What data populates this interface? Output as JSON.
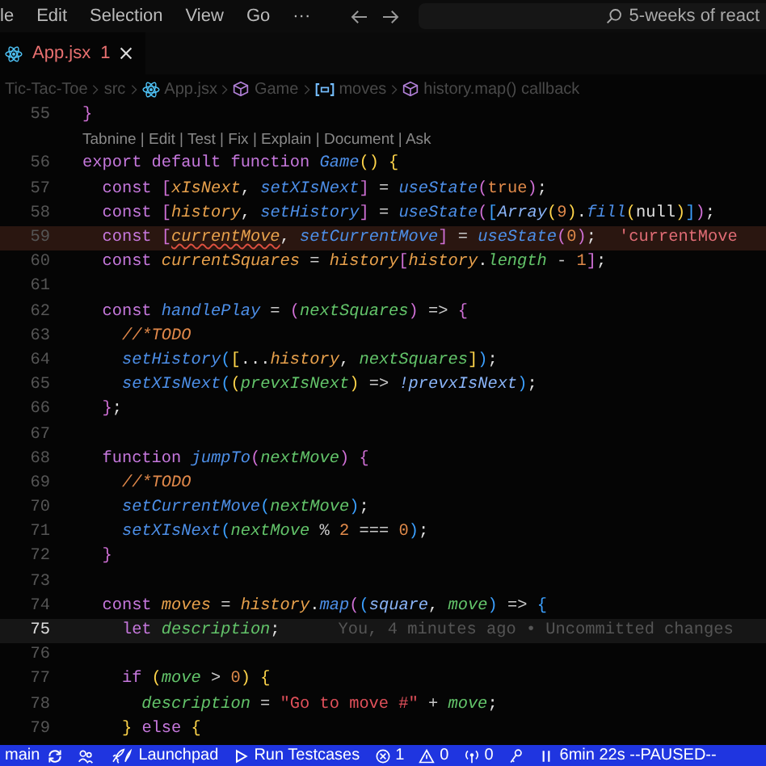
{
  "menu": [
    "le",
    "Edit",
    "Selection",
    "View",
    "Go",
    "···"
  ],
  "search": {
    "value": "5-weeks of react"
  },
  "tab": {
    "label": "App.jsx",
    "problems": "1"
  },
  "breadcrumb": [
    {
      "kind": "folder",
      "label": "Tic-Tac-Toe"
    },
    {
      "kind": "folder",
      "label": "src"
    },
    {
      "kind": "react",
      "label": "App.jsx"
    },
    {
      "kind": "symbol",
      "label": "Game"
    },
    {
      "kind": "variable",
      "label": "moves"
    },
    {
      "kind": "symbol",
      "label": "history.map() callback"
    }
  ],
  "lines": [
    {
      "number": "55",
      "tokens": [
        {
          "kind": "b2",
          "t": "}"
        }
      ]
    },
    {
      "number": "56",
      "codelens": "Tabnine | Edit | Test | Fix | Explain | Document | Ask",
      "tokens": [
        {
          "kind": "kw",
          "t": "export default function "
        },
        {
          "kind": "fn",
          "t": "Game"
        },
        {
          "kind": "b1",
          "t": "() {"
        }
      ]
    },
    {
      "number": "57",
      "tokens": [
        {
          "kind": "kw",
          "t": "  const "
        },
        {
          "kind": "b2",
          "t": "["
        },
        {
          "kind": "var",
          "t": "xIsNext"
        },
        {
          "kind": "pn",
          "t": ", "
        },
        {
          "kind": "fn",
          "t": "setXIsNext"
        },
        {
          "kind": "b2",
          "t": "]"
        },
        {
          "kind": "op",
          "t": " = "
        },
        {
          "kind": "fn",
          "t": "useState"
        },
        {
          "kind": "b2",
          "t": "("
        },
        {
          "kind": "num",
          "t": "true"
        },
        {
          "kind": "b2",
          "t": ")"
        },
        {
          "kind": "pn",
          "t": ";"
        }
      ]
    },
    {
      "number": "58",
      "tokens": [
        {
          "kind": "kw",
          "t": "  const "
        },
        {
          "kind": "b2",
          "t": "["
        },
        {
          "kind": "var",
          "t": "history"
        },
        {
          "kind": "pn",
          "t": ", "
        },
        {
          "kind": "fn",
          "t": "setHistory"
        },
        {
          "kind": "b2",
          "t": "]"
        },
        {
          "kind": "op",
          "t": " = "
        },
        {
          "kind": "fn",
          "t": "useState"
        },
        {
          "kind": "b2",
          "t": "("
        },
        {
          "kind": "b3",
          "t": "["
        },
        {
          "kind": "ref",
          "t": "Array"
        },
        {
          "kind": "b1",
          "t": "("
        },
        {
          "kind": "num",
          "t": "9"
        },
        {
          "kind": "b1",
          "t": ")"
        },
        {
          "kind": "pn",
          "t": "."
        },
        {
          "kind": "fn",
          "t": "fill"
        },
        {
          "kind": "b1",
          "t": "("
        },
        {
          "kind": "pn",
          "t": "null"
        },
        {
          "kind": "b1",
          "t": ")"
        },
        {
          "kind": "b3",
          "t": "]"
        },
        {
          "kind": "b2",
          "t": ")"
        },
        {
          "kind": "pn",
          "t": ";"
        }
      ]
    },
    {
      "number": "59",
      "error": true,
      "hint": "'currentMove",
      "tokens": [
        {
          "kind": "kw",
          "t": "  const "
        },
        {
          "kind": "b2",
          "t": "["
        },
        {
          "kind": "var",
          "t": "currentMove",
          "squiggle": true
        },
        {
          "kind": "pn",
          "t": ", "
        },
        {
          "kind": "fn",
          "t": "setCurrentMove"
        },
        {
          "kind": "b2",
          "t": "]"
        },
        {
          "kind": "op",
          "t": " = "
        },
        {
          "kind": "fn",
          "t": "useState"
        },
        {
          "kind": "b2",
          "t": "("
        },
        {
          "kind": "num",
          "t": "0"
        },
        {
          "kind": "b2",
          "t": ")"
        },
        {
          "kind": "pn",
          "t": ";"
        }
      ]
    },
    {
      "number": "60",
      "tokens": [
        {
          "kind": "kw",
          "t": "  const "
        },
        {
          "kind": "var",
          "t": "currentSquares"
        },
        {
          "kind": "op",
          "t": " = "
        },
        {
          "kind": "var",
          "t": "history"
        },
        {
          "kind": "b2",
          "t": "["
        },
        {
          "kind": "var",
          "t": "history"
        },
        {
          "kind": "pn",
          "t": "."
        },
        {
          "kind": "prop",
          "t": "length"
        },
        {
          "kind": "op",
          "t": " - "
        },
        {
          "kind": "num",
          "t": "1"
        },
        {
          "kind": "b2",
          "t": "]"
        },
        {
          "kind": "pn",
          "t": ";"
        }
      ]
    },
    {
      "number": "61"
    },
    {
      "number": "62",
      "tokens": [
        {
          "kind": "kw",
          "t": "  const "
        },
        {
          "kind": "fn",
          "t": "handlePlay"
        },
        {
          "kind": "op",
          "t": " = "
        },
        {
          "kind": "b2",
          "t": "("
        },
        {
          "kind": "param",
          "t": "nextSquares"
        },
        {
          "kind": "b2",
          "t": ")"
        },
        {
          "kind": "op",
          "t": " => "
        },
        {
          "kind": "b2",
          "t": "{"
        }
      ]
    },
    {
      "number": "63",
      "tokens": [
        {
          "kind": "com",
          "t": "    //*TODO"
        }
      ]
    },
    {
      "number": "64",
      "tokens": [
        {
          "kind": "fn",
          "t": "    setHistory"
        },
        {
          "kind": "b3",
          "t": "("
        },
        {
          "kind": "b1",
          "t": "["
        },
        {
          "kind": "pn",
          "t": "..."
        },
        {
          "kind": "var",
          "t": "history"
        },
        {
          "kind": "pn",
          "t": ", "
        },
        {
          "kind": "param",
          "t": "nextSquares"
        },
        {
          "kind": "b1",
          "t": "]"
        },
        {
          "kind": "b3",
          "t": ")"
        },
        {
          "kind": "pn",
          "t": ";"
        }
      ]
    },
    {
      "number": "65",
      "tokens": [
        {
          "kind": "fn",
          "t": "    setXIsNext"
        },
        {
          "kind": "b3",
          "t": "("
        },
        {
          "kind": "b1",
          "t": "("
        },
        {
          "kind": "param",
          "t": "prevxIsNext"
        },
        {
          "kind": "b1",
          "t": ")"
        },
        {
          "kind": "op",
          "t": " => "
        },
        {
          "kind": "ref",
          "t": "!prevxIsNext"
        },
        {
          "kind": "b3",
          "t": ")"
        },
        {
          "kind": "pn",
          "t": ";"
        }
      ]
    },
    {
      "number": "66",
      "tokens": [
        {
          "kind": "b2",
          "t": "  }"
        },
        {
          "kind": "pn",
          "t": ";"
        }
      ]
    },
    {
      "number": "67"
    },
    {
      "number": "68",
      "tokens": [
        {
          "kind": "kw",
          "t": "  function "
        },
        {
          "kind": "fn",
          "t": "jumpTo"
        },
        {
          "kind": "b2",
          "t": "("
        },
        {
          "kind": "param",
          "t": "nextMove"
        },
        {
          "kind": "b2",
          "t": ") {"
        }
      ]
    },
    {
      "number": "69",
      "tokens": [
        {
          "kind": "com",
          "t": "    //*TODO"
        }
      ]
    },
    {
      "number": "70",
      "tokens": [
        {
          "kind": "fn",
          "t": "    setCurrentMove"
        },
        {
          "kind": "b3",
          "t": "("
        },
        {
          "kind": "param",
          "t": "nextMove"
        },
        {
          "kind": "b3",
          "t": ")"
        },
        {
          "kind": "pn",
          "t": ";"
        }
      ]
    },
    {
      "number": "71",
      "tokens": [
        {
          "kind": "fn",
          "t": "    setXIsNext"
        },
        {
          "kind": "b3",
          "t": "("
        },
        {
          "kind": "param",
          "t": "nextMove"
        },
        {
          "kind": "op",
          "t": " % "
        },
        {
          "kind": "num",
          "t": "2"
        },
        {
          "kind": "op",
          "t": " === "
        },
        {
          "kind": "num",
          "t": "0"
        },
        {
          "kind": "b3",
          "t": ")"
        },
        {
          "kind": "pn",
          "t": ";"
        }
      ]
    },
    {
      "number": "72",
      "tokens": [
        {
          "kind": "b2",
          "t": "  }"
        }
      ]
    },
    {
      "number": "73"
    },
    {
      "number": "74",
      "tokens": [
        {
          "kind": "kw",
          "t": "  const "
        },
        {
          "kind": "var",
          "t": "moves"
        },
        {
          "kind": "op",
          "t": " = "
        },
        {
          "kind": "var",
          "t": "history"
        },
        {
          "kind": "pn",
          "t": "."
        },
        {
          "kind": "fn",
          "t": "map"
        },
        {
          "kind": "b2",
          "t": "("
        },
        {
          "kind": "b3",
          "t": "("
        },
        {
          "kind": "ref",
          "t": "square"
        },
        {
          "kind": "pn",
          "t": ", "
        },
        {
          "kind": "param",
          "t": "move"
        },
        {
          "kind": "b3",
          "t": ")"
        },
        {
          "kind": "op",
          "t": " => "
        },
        {
          "kind": "b3",
          "t": "{"
        }
      ]
    },
    {
      "number": "75",
      "current": true,
      "blame": "You, 4 minutes ago • Uncommitted changes",
      "tokens": [
        {
          "kind": "kw",
          "t": "    let "
        },
        {
          "kind": "param",
          "t": "description"
        },
        {
          "kind": "pn",
          "t": ";"
        }
      ]
    },
    {
      "number": "76"
    },
    {
      "number": "77",
      "tokens": [
        {
          "kind": "kw",
          "t": "    if "
        },
        {
          "kind": "b1",
          "t": "("
        },
        {
          "kind": "param",
          "t": "move"
        },
        {
          "kind": "op",
          "t": " > "
        },
        {
          "kind": "num",
          "t": "0"
        },
        {
          "kind": "b1",
          "t": ") {"
        }
      ]
    },
    {
      "number": "78",
      "tokens": [
        {
          "kind": "param",
          "t": "      description"
        },
        {
          "kind": "op",
          "t": " = "
        },
        {
          "kind": "str",
          "t": "\"Go to move #\""
        },
        {
          "kind": "op",
          "t": " + "
        },
        {
          "kind": "param",
          "t": "move"
        },
        {
          "kind": "pn",
          "t": ";"
        }
      ]
    },
    {
      "number": "79",
      "tokens": [
        {
          "kind": "b1",
          "t": "    } "
        },
        {
          "kind": "kw",
          "t": "else "
        },
        {
          "kind": "b1",
          "t": "{"
        }
      ]
    }
  ],
  "status_bar": [
    {
      "kind": "branch",
      "label": "main"
    },
    {
      "kind": "sync"
    },
    {
      "kind": "accounts"
    },
    {
      "kind": "launchpad",
      "label": "Launchpad"
    },
    {
      "kind": "run",
      "label": "Run Testcases"
    },
    {
      "kind": "errors",
      "label": "1"
    },
    {
      "kind": "warnings",
      "label": "0"
    },
    {
      "kind": "ports",
      "label": "0"
    },
    {
      "kind": "key"
    },
    {
      "kind": "timer",
      "label": "6min 22s --PAUSED--"
    }
  ]
}
